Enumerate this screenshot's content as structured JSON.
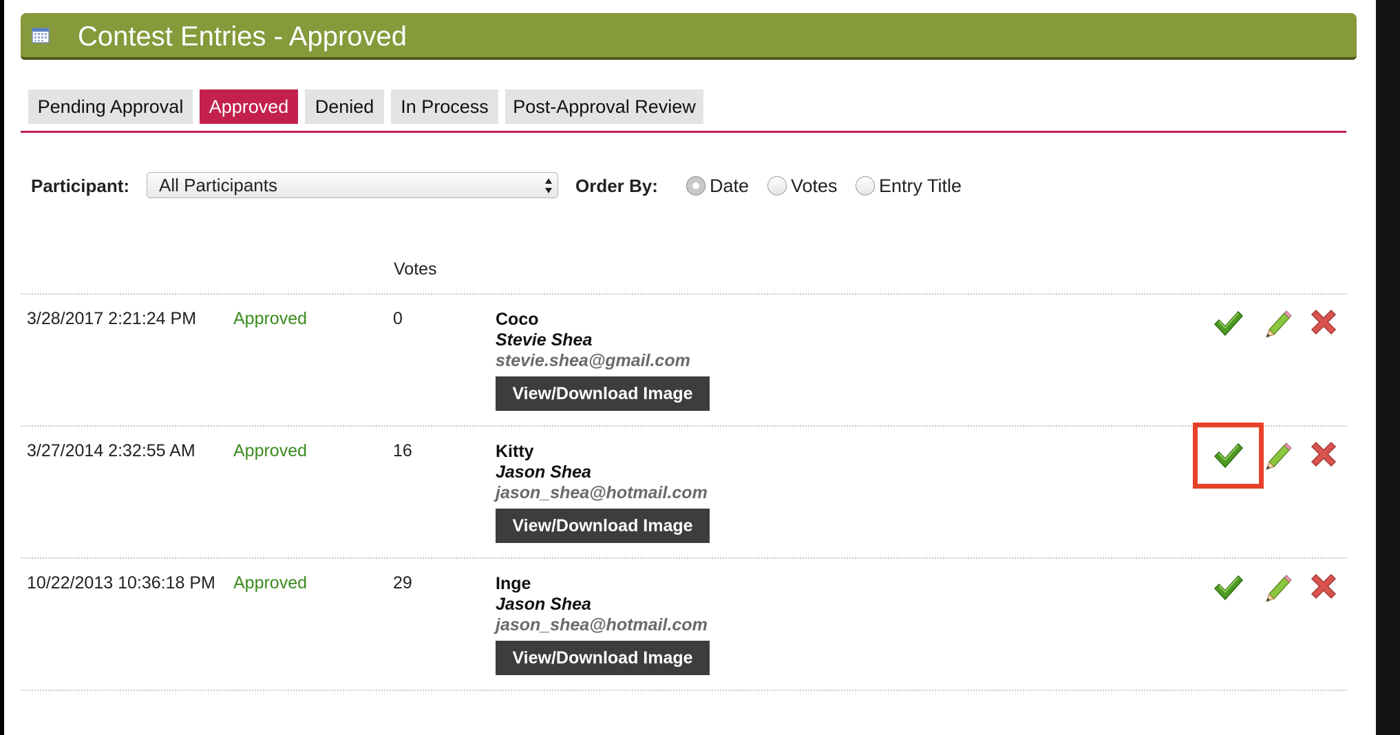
{
  "header": {
    "title": "Contest Entries - Approved"
  },
  "tabs": [
    {
      "label": "Pending Approval",
      "active": false
    },
    {
      "label": "Approved",
      "active": true
    },
    {
      "label": "Denied",
      "active": false
    },
    {
      "label": "In Process",
      "active": false
    },
    {
      "label": "Post-Approval Review",
      "active": false
    }
  ],
  "filters": {
    "participant_label": "Participant:",
    "participant_value": "All Participants",
    "order_label": "Order By:",
    "order_options": [
      {
        "label": "Date",
        "checked": true
      },
      {
        "label": "Votes",
        "checked": false
      },
      {
        "label": "Entry Title",
        "checked": false
      }
    ]
  },
  "table": {
    "votes_header": "Votes",
    "view_button_label": "View/Download Image",
    "rows": [
      {
        "date": "3/28/2017 2:21:24 PM",
        "status": "Approved",
        "votes": "0",
        "entry": "Coco",
        "author": "Stevie Shea",
        "email": "stevie.shea@gmail.com"
      },
      {
        "date": "3/27/2014 2:32:55 AM",
        "status": "Approved",
        "votes": "16",
        "entry": "Kitty",
        "author": "Jason Shea",
        "email": "jason_shea@hotmail.com"
      },
      {
        "date": "10/22/2013 10:36:18 PM",
        "status": "Approved",
        "votes": "29",
        "entry": "Inge",
        "author": "Jason Shea",
        "email": "jason_shea@hotmail.com"
      }
    ],
    "actions": [
      "check-icon",
      "pencil-icon",
      "x-icon"
    ]
  },
  "colors": {
    "header": "#869a3c",
    "accent": "#c3204e",
    "status_green": "#3a8a1c",
    "highlight": "#e8412a"
  }
}
